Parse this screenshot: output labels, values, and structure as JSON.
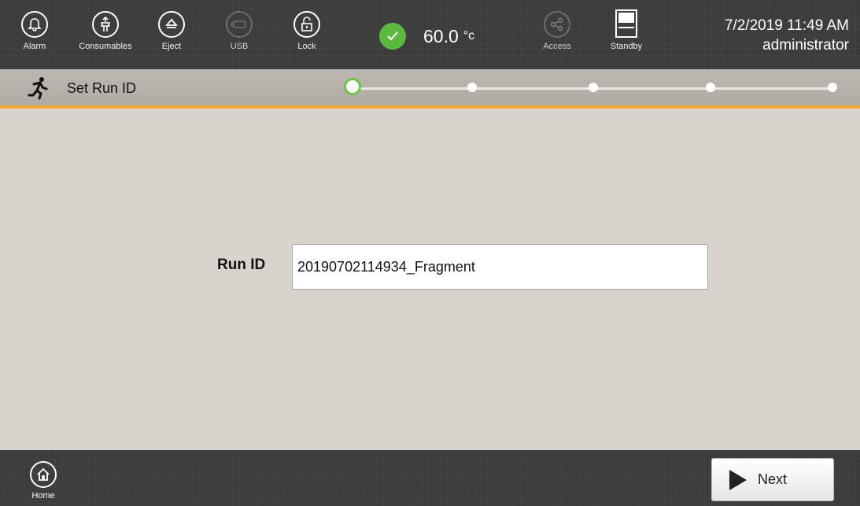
{
  "topbar": {
    "buttons": [
      {
        "label": "Alarm",
        "icon": "bell-icon",
        "enabled": true
      },
      {
        "label": "Consumables",
        "icon": "consumables-icon",
        "enabled": true
      },
      {
        "label": "Eject",
        "icon": "eject-icon",
        "enabled": true
      },
      {
        "label": "USB",
        "icon": "usb-icon",
        "enabled": false
      },
      {
        "label": "Lock",
        "icon": "lock-icon",
        "enabled": true
      },
      {
        "label": "Access",
        "icon": "share-icon",
        "enabled": false
      },
      {
        "label": "Standby",
        "icon": "standby-icon",
        "enabled": true
      }
    ],
    "temperature": {
      "value": "60.0",
      "unit": "°c",
      "status_icon": "check-icon",
      "status_color": "#5cb93f"
    },
    "datetime": "7/2/2019 11:49 AM",
    "user": "administrator"
  },
  "stepbar": {
    "icon": "runner-icon",
    "title": "Set Run ID",
    "steps_total": 5,
    "current_step": 1,
    "accent_color": "#f0a830"
  },
  "form": {
    "run_id_label": "Run ID",
    "run_id_value": "20190702114934_Fragment"
  },
  "bottombar": {
    "home_label": "Home",
    "next_label": "Next"
  }
}
